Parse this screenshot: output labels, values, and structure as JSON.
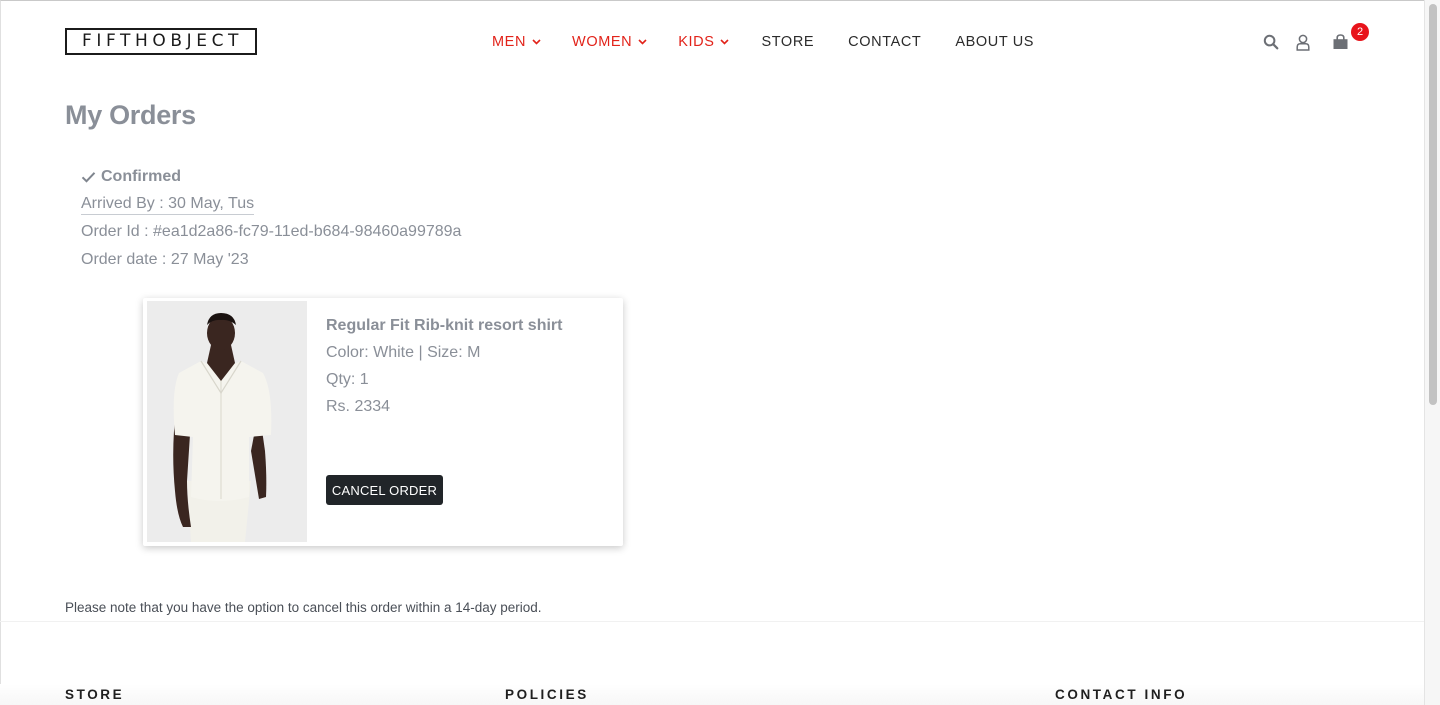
{
  "brand": {
    "logo_text": "FIFTHOBJECT"
  },
  "nav": {
    "items": [
      {
        "label": "MEN",
        "has_dropdown": true,
        "color": "#e2231a"
      },
      {
        "label": "WOMEN",
        "has_dropdown": true,
        "color": "#e2231a"
      },
      {
        "label": "KIDS",
        "has_dropdown": true,
        "color": "#e2231a"
      },
      {
        "label": "STORE",
        "has_dropdown": false
      },
      {
        "label": "CONTACT",
        "has_dropdown": false
      },
      {
        "label": "ABOUT US",
        "has_dropdown": false
      }
    ]
  },
  "header_icons": [
    "search-icon",
    "user-icon",
    "cart-icon"
  ],
  "cart": {
    "count": "2",
    "badge_color": "#e8141b"
  },
  "page": {
    "title": "My Orders"
  },
  "order": {
    "status": "Confirmed",
    "arrived_by": "Arrived By :  30 May, Tus",
    "order_id": "Order Id : #ea1d2a86-fc79-11ed-b684-98460a99789a",
    "order_date": "Order date : 27 May '23",
    "item": {
      "name": "Regular Fit Rib-knit resort shirt",
      "color_size": "Color: White |  Size: M",
      "qty": "Qty: 1",
      "price": "Rs. 2334",
      "image_alt": "model wearing white rib-knit resort shirt"
    },
    "cancel_label": "CANCEL ORDER"
  },
  "note": "Please note that you have the option to cancel this order within a 14-day period.",
  "footer": {
    "headings": [
      "STORE",
      "POLICIES",
      "CONTACT INFO"
    ]
  }
}
